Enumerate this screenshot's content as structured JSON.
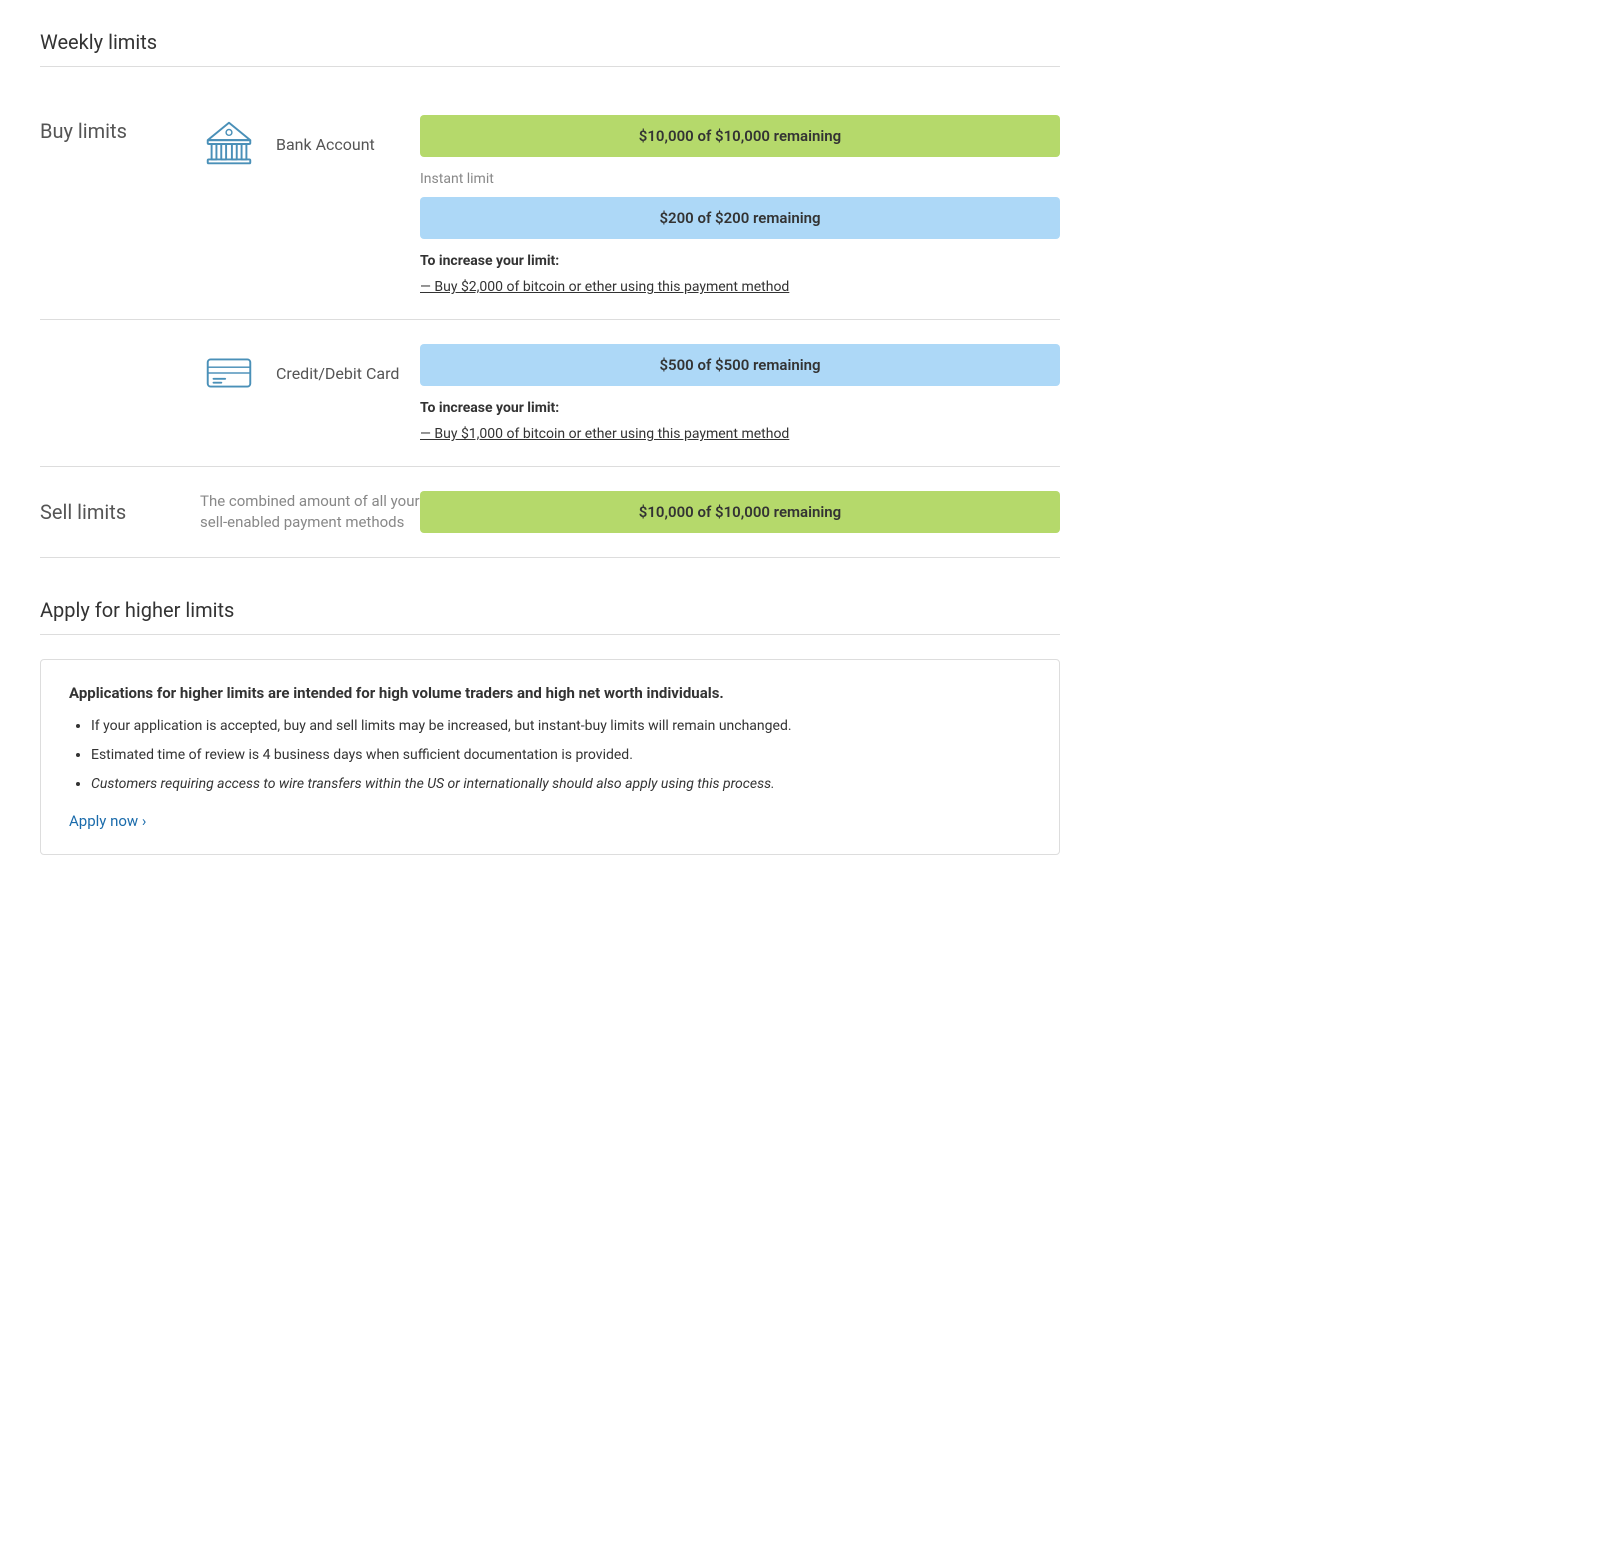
{
  "weekly_limits": {
    "title": "Weekly limits"
  },
  "buy_limits": {
    "label": "Buy limits",
    "overall_bar": "$10,000 of $10,000 remaining",
    "bank_account": {
      "name": "Bank Account",
      "instant_label": "Instant limit",
      "instant_bar": "$200 of $200 remaining",
      "increase_label": "To increase your limit:",
      "increase_text": "— Buy $2,000 of bitcoin or ether using this payment method"
    },
    "credit_card": {
      "name": "Credit/Debit Card",
      "bar": "$500 of $500 remaining",
      "increase_label": "To increase your limit:",
      "increase_text": "— Buy $1,000 of bitcoin or ether using this payment method"
    }
  },
  "sell_limits": {
    "label": "Sell limits",
    "description": "The combined amount of all your sell-enabled payment methods",
    "bar": "$10,000 of $10,000 remaining"
  },
  "apply_section": {
    "title": "Apply for higher limits",
    "bold_text": "Applications for higher limits are intended for high volume traders and high net worth individuals.",
    "bullet_1": "If your application is accepted, buy and sell limits may be increased, but instant-buy limits will remain unchanged.",
    "bullet_2": "Estimated time of review is 4 business days when sufficient documentation is provided.",
    "bullet_3": "Customers requiring access to wire transfers within the US or internationally should also apply using this process.",
    "apply_link": "Apply now ›"
  }
}
